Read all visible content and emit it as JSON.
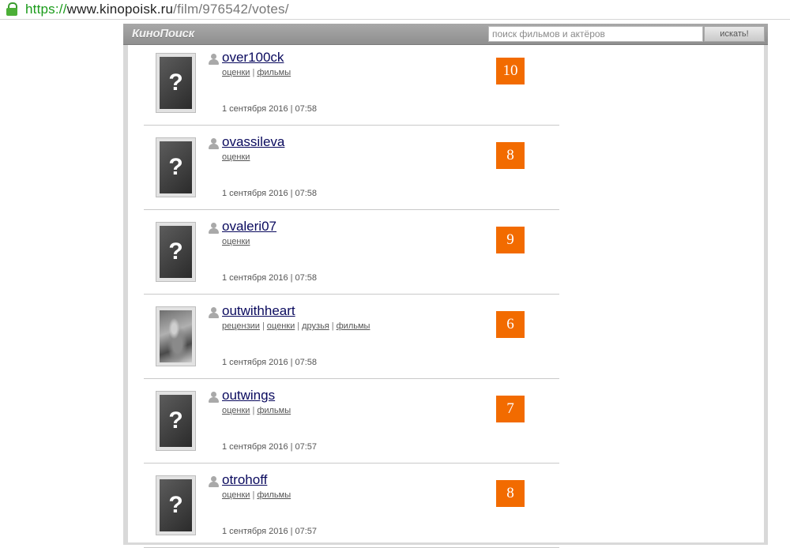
{
  "address_bar": {
    "scheme": "https://",
    "host": "www.kinopoisk.ru",
    "path": "/film/976542/votes/"
  },
  "header": {
    "logo": "КиноПоиск",
    "search_placeholder": "поиск фильмов и актёров",
    "search_button": "искать!"
  },
  "votes": [
    {
      "username": "over100ck",
      "links": [
        "оценки",
        "фильмы"
      ],
      "date": "1 сентября 2016",
      "time": "07:58",
      "score": "10",
      "avatar": "placeholder"
    },
    {
      "username": "ovassileva",
      "links": [
        "оценки"
      ],
      "date": "1 сентября 2016",
      "time": "07:58",
      "score": "8",
      "avatar": "placeholder"
    },
    {
      "username": "ovaleri07",
      "links": [
        "оценки"
      ],
      "date": "1 сентября 2016",
      "time": "07:58",
      "score": "9",
      "avatar": "placeholder"
    },
    {
      "username": "outwithheart",
      "links": [
        "рецензии",
        "оценки",
        "друзья",
        "фильмы"
      ],
      "date": "1 сентября 2016",
      "time": "07:58",
      "score": "6",
      "avatar": "photo"
    },
    {
      "username": "outwings",
      "links": [
        "оценки",
        "фильмы"
      ],
      "date": "1 сентября 2016",
      "time": "07:57",
      "score": "7",
      "avatar": "placeholder"
    },
    {
      "username": "otrohoff",
      "links": [
        "оценки",
        "фильмы"
      ],
      "date": "1 сентября 2016",
      "time": "07:57",
      "score": "8",
      "avatar": "placeholder"
    }
  ],
  "avatar_placeholder_glyph": "?",
  "colors": {
    "score_bg": "#f26b00",
    "username": "#0a0a5e",
    "url_scheme": "#1a9b1a"
  }
}
